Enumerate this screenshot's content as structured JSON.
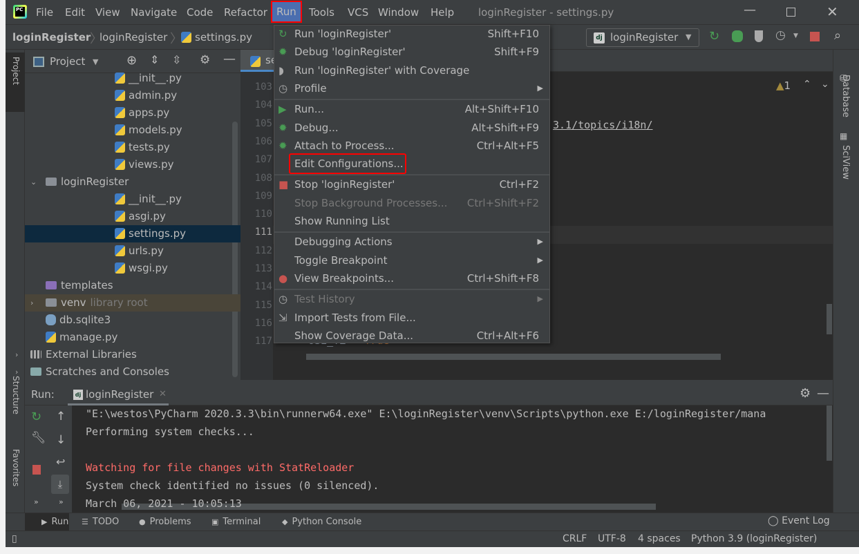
{
  "window": {
    "title": "loginRegister - settings.py"
  },
  "menubar": [
    "File",
    "Edit",
    "View",
    "Navigate",
    "Code",
    "Refactor",
    "Run",
    "Tools",
    "VCS",
    "Window",
    "Help"
  ],
  "breadcrumb": [
    "loginRegister",
    "loginRegister",
    "settings.py"
  ],
  "toolbar": {
    "run_config": "loginRegister"
  },
  "project_panel": {
    "title": "Project"
  },
  "tree": [
    {
      "label": "__init__.py",
      "type": "py",
      "indent": 2
    },
    {
      "label": "admin.py",
      "type": "py",
      "indent": 2
    },
    {
      "label": "apps.py",
      "type": "py",
      "indent": 2
    },
    {
      "label": "models.py",
      "type": "py",
      "indent": 2
    },
    {
      "label": "tests.py",
      "type": "py",
      "indent": 2
    },
    {
      "label": "views.py",
      "type": "py",
      "indent": 2
    },
    {
      "label": "loginRegister",
      "type": "folder",
      "indent": 1,
      "expanded": true
    },
    {
      "label": "__init__.py",
      "type": "py",
      "indent": 2
    },
    {
      "label": "asgi.py",
      "type": "py",
      "indent": 2
    },
    {
      "label": "settings.py",
      "type": "py",
      "indent": 2,
      "selected": true
    },
    {
      "label": "urls.py",
      "type": "py",
      "indent": 2
    },
    {
      "label": "wsgi.py",
      "type": "py",
      "indent": 2
    },
    {
      "label": "templates",
      "type": "folder-purple",
      "indent": 1
    },
    {
      "label": "venv",
      "type": "folder",
      "indent": 1,
      "collapsed": true,
      "note": "library root"
    },
    {
      "label": "db.sqlite3",
      "type": "db",
      "indent": 1
    },
    {
      "label": "manage.py",
      "type": "py",
      "indent": 1
    },
    {
      "label": "External Libraries",
      "type": "lib",
      "indent": 0,
      "collapsed": true
    },
    {
      "label": "Scratches and Consoles",
      "type": "scratch",
      "indent": 0,
      "collapsed": true
    }
  ],
  "editor": {
    "tab": "se",
    "line_numbers": [
      "103",
      "104",
      "105",
      "106",
      "107",
      "108",
      "109",
      "110",
      "111",
      "112",
      "113",
      "114",
      "115",
      "116",
      "117"
    ],
    "current_line": "111",
    "visible_code": {
      "link": "3.1/topics/i18n/",
      "line117_prefix": "USE_TZ = ",
      "line117_value": "True"
    },
    "warnings": "1"
  },
  "run_menu": [
    {
      "label": "Run 'loginRegister'",
      "shortcut": "Shift+F10",
      "icon": "rerun-icon"
    },
    {
      "label": "Debug 'loginRegister'",
      "shortcut": "Shift+F9",
      "icon": "bug-icon"
    },
    {
      "label": "Run 'loginRegister' with Coverage",
      "shortcut": "",
      "icon": "coverage-icon"
    },
    {
      "label": "Profile",
      "shortcut": "",
      "icon": "profile-icon",
      "submenu": true,
      "sep_after": true
    },
    {
      "label": "Run...",
      "shortcut": "Alt+Shift+F10",
      "icon": "play-icon"
    },
    {
      "label": "Debug...",
      "shortcut": "Alt+Shift+F9",
      "icon": "bug-icon"
    },
    {
      "label": "Attach to Process...",
      "shortcut": "Ctrl+Alt+F5",
      "icon": "attach-icon"
    },
    {
      "label": "Edit Configurations...",
      "shortcut": "",
      "highlighted_box": true,
      "sep_after": true
    },
    {
      "label": "Stop 'loginRegister'",
      "shortcut": "Ctrl+F2",
      "icon": "stop-icon"
    },
    {
      "label": "Stop Background Processes...",
      "shortcut": "Ctrl+Shift+F2",
      "disabled": true
    },
    {
      "label": "Show Running List",
      "shortcut": "",
      "sep_after": true
    },
    {
      "label": "Debugging Actions",
      "shortcut": "",
      "submenu": true
    },
    {
      "label": "Toggle Breakpoint",
      "shortcut": "",
      "submenu": true
    },
    {
      "label": "View Breakpoints...",
      "shortcut": "Ctrl+Shift+F8",
      "icon": "breakpoints-icon",
      "sep_after": true
    },
    {
      "label": "Test History",
      "shortcut": "",
      "icon": "clock-icon",
      "submenu": true,
      "disabled": true
    },
    {
      "label": "Import Tests from File...",
      "shortcut": "",
      "icon": "import-icon"
    },
    {
      "label": "Show Coverage Data...",
      "shortcut": "Ctrl+Alt+F6"
    }
  ],
  "right_stripe": [
    "Database",
    "SciView"
  ],
  "left_stripe": [
    "Project",
    "Structure",
    "Favorites"
  ],
  "run_panel": {
    "label": "Run:",
    "tab": "loginRegister",
    "output": [
      {
        "text": "\"E:\\westos\\PyCharm 2020.3.3\\bin\\runnerw64.exe\" E:\\loginRegister\\venv\\Scripts\\python.exe E:/loginRegister/mana",
        "color": "#bbbbbb"
      },
      {
        "text": "Performing system checks...",
        "color": "#bbbbbb"
      },
      {
        "text": "",
        "color": "#bbbbbb"
      },
      {
        "text": "Watching for file changes with StatReloader",
        "color": "#ff6b68"
      },
      {
        "text": "System check identified no issues (0 silenced).",
        "color": "#bbbbbb"
      },
      {
        "text": "March 06, 2021 - 10:05:13",
        "color": "#bbbbbb"
      }
    ]
  },
  "tool_tabs": [
    "Run",
    "TODO",
    "Problems",
    "Terminal",
    "Python Console"
  ],
  "event_log": "Event Log",
  "status": {
    "line_sep": "CRLF",
    "encoding": "UTF-8",
    "indent": "4 spaces",
    "interpreter": "Python 3.9 (loginRegister)"
  },
  "colors": {
    "accent": "#4b6eaf",
    "highlight_box": "#ff0000",
    "selection": "#0d293e",
    "green": "#499c54",
    "red": "#c75450"
  }
}
